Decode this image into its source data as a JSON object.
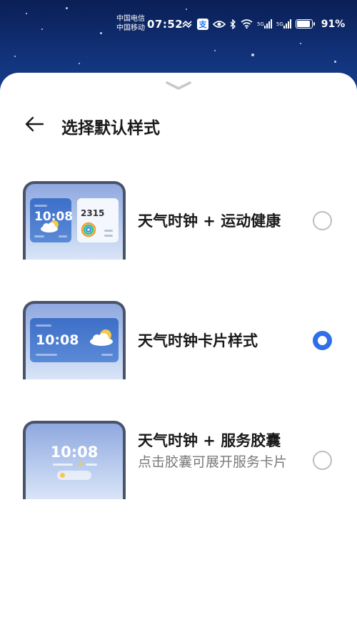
{
  "status_bar": {
    "carrier_1": "中国电信",
    "carrier_2": "中国移动",
    "time": "07:52",
    "alipay_icon_text": "支",
    "signal_tag_1": "5G",
    "signal_tag_2": "5G",
    "battery_percent": "91%",
    "battery_level": 0.91
  },
  "sheet": {
    "title": "选择默认样式",
    "options": [
      {
        "label": "天气时钟 + 运动健康",
        "preview_time": "10:08",
        "preview_steps": "2315",
        "selected": false
      },
      {
        "label": "天气时钟卡片样式",
        "preview_time": "10:08",
        "selected": true
      },
      {
        "label": "天气时钟 + 服务胶囊",
        "sublabel": "点击胶囊可展开服务卡片",
        "preview_time": "10:08",
        "selected": false
      }
    ]
  },
  "colors": {
    "accent": "#2f6fe8",
    "wallpaper": "#12337c"
  },
  "icons": [
    "eye-icon",
    "bluetooth-icon",
    "wifi-icon",
    "signal-icon",
    "battery-icon",
    "chevron-down-icon",
    "back-arrow-icon",
    "sun-cloud-icon",
    "activity-ring-icon"
  ]
}
